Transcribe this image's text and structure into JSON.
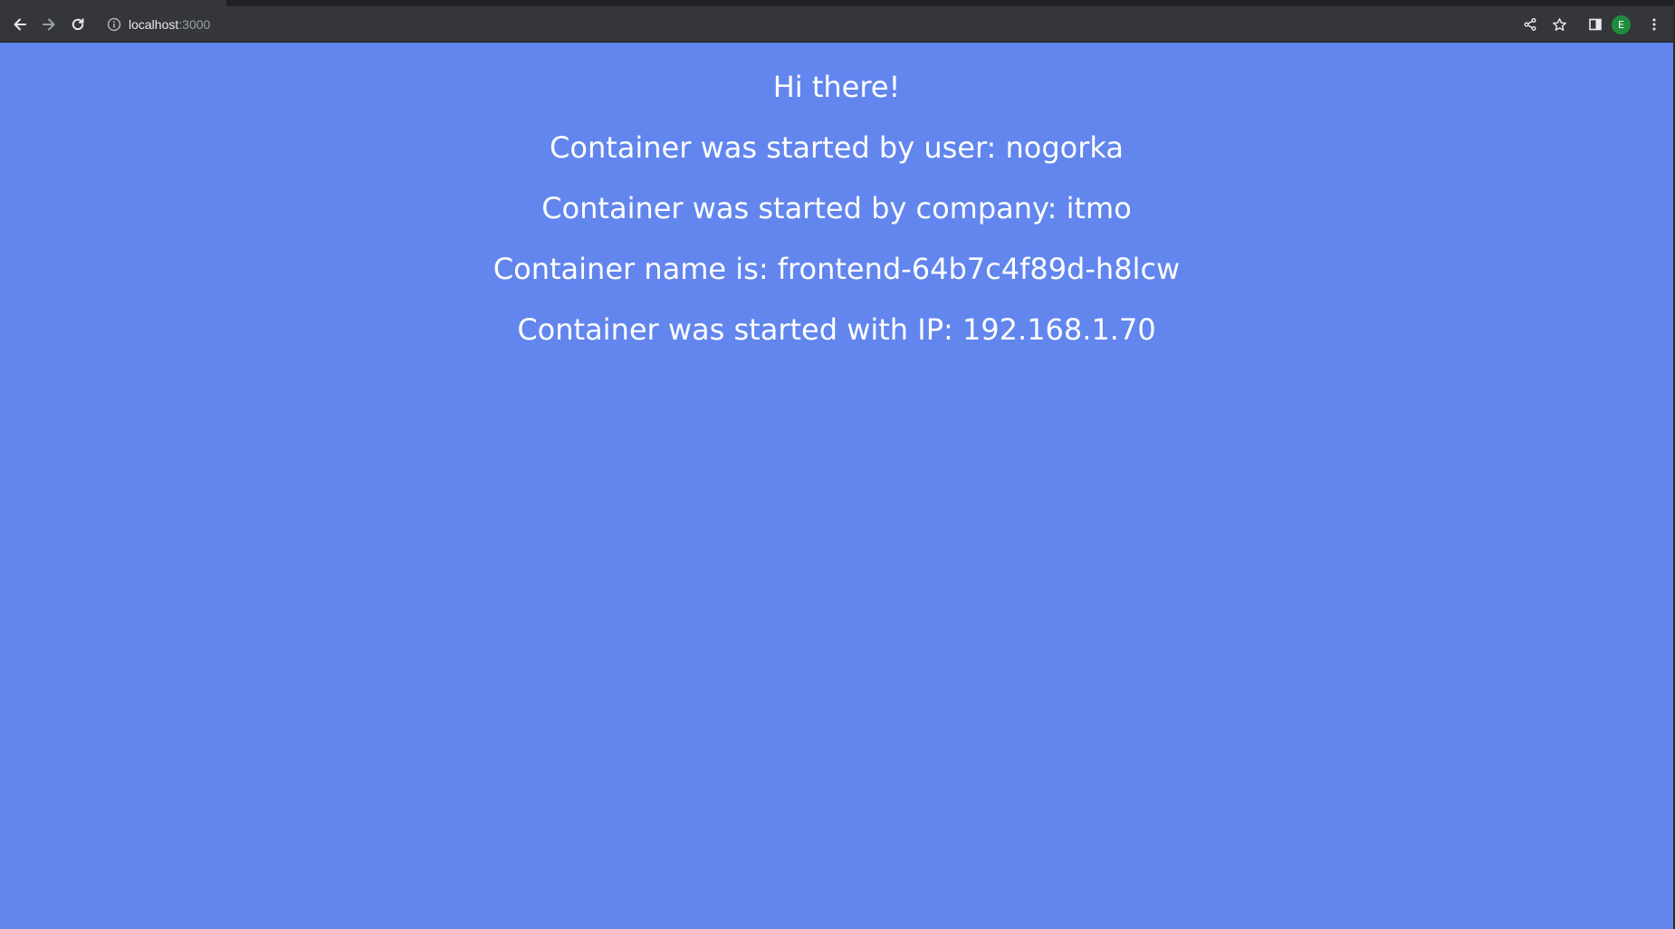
{
  "browser": {
    "url_host": "localhost",
    "url_port": ":3000",
    "profile_initial": "E",
    "icons": [
      "back-arrow-icon",
      "forward-arrow-icon",
      "reload-icon",
      "info-icon",
      "share-icon",
      "star-icon",
      "side-panel-icon",
      "kebab-menu-icon"
    ]
  },
  "page": {
    "greeting": "Hi there!",
    "user_line": "Container was started by user: nogorka",
    "company_line": "Container was started by company: itmo",
    "name_line": "Container name is: frontend-64b7c4f89d-h8lcw",
    "ip_line": "Container was started with IP: 192.168.1.70",
    "background_color": "#6286ee"
  }
}
